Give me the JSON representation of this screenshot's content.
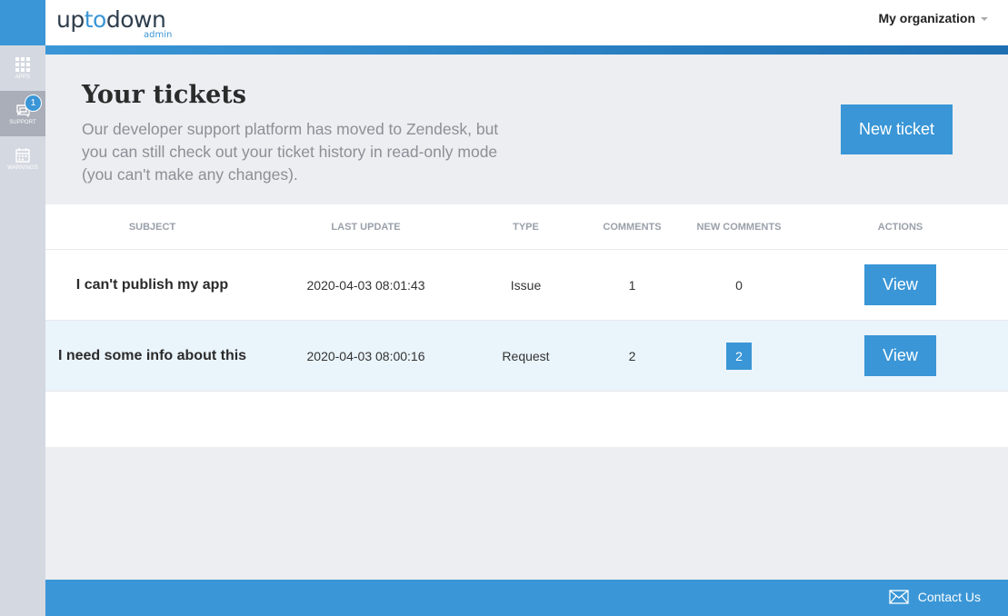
{
  "sidebar": {
    "items": [
      {
        "label": "APPS",
        "icon": "grid-icon"
      },
      {
        "label": "SUPPORT",
        "icon": "support-icon",
        "badge": "1"
      },
      {
        "label": "WARNINGS",
        "icon": "calendar-icon"
      }
    ]
  },
  "header": {
    "logo_text": "uptodown",
    "logo_sub": "admin",
    "organization": "My organization"
  },
  "hero": {
    "title": "Your tickets",
    "description": "Our developer support platform has moved to Zendesk, but you can still check out your ticket history in read-only mode (you can't make any changes).",
    "new_ticket_label": "New ticket"
  },
  "table": {
    "headers": [
      "SUBJECT",
      "LAST UPDATE",
      "TYPE",
      "COMMENTS",
      "NEW COMMENTS",
      "ACTIONS"
    ],
    "rows": [
      {
        "subject": "I can't publish my app",
        "last_update": "2020-04-03 08:01:43",
        "type": "Issue",
        "comments": "1",
        "new_comments": "0",
        "action": "View"
      },
      {
        "subject": "I need some info about this",
        "last_update": "2020-04-03 08:00:16",
        "type": "Request",
        "comments": "2",
        "new_comments": "2",
        "action": "View"
      }
    ]
  },
  "footer": {
    "contact_label": "Contact Us"
  },
  "colors": {
    "accent": "#3a96d6",
    "sidebar": "#d4d8e0",
    "background": "#eceef2"
  }
}
